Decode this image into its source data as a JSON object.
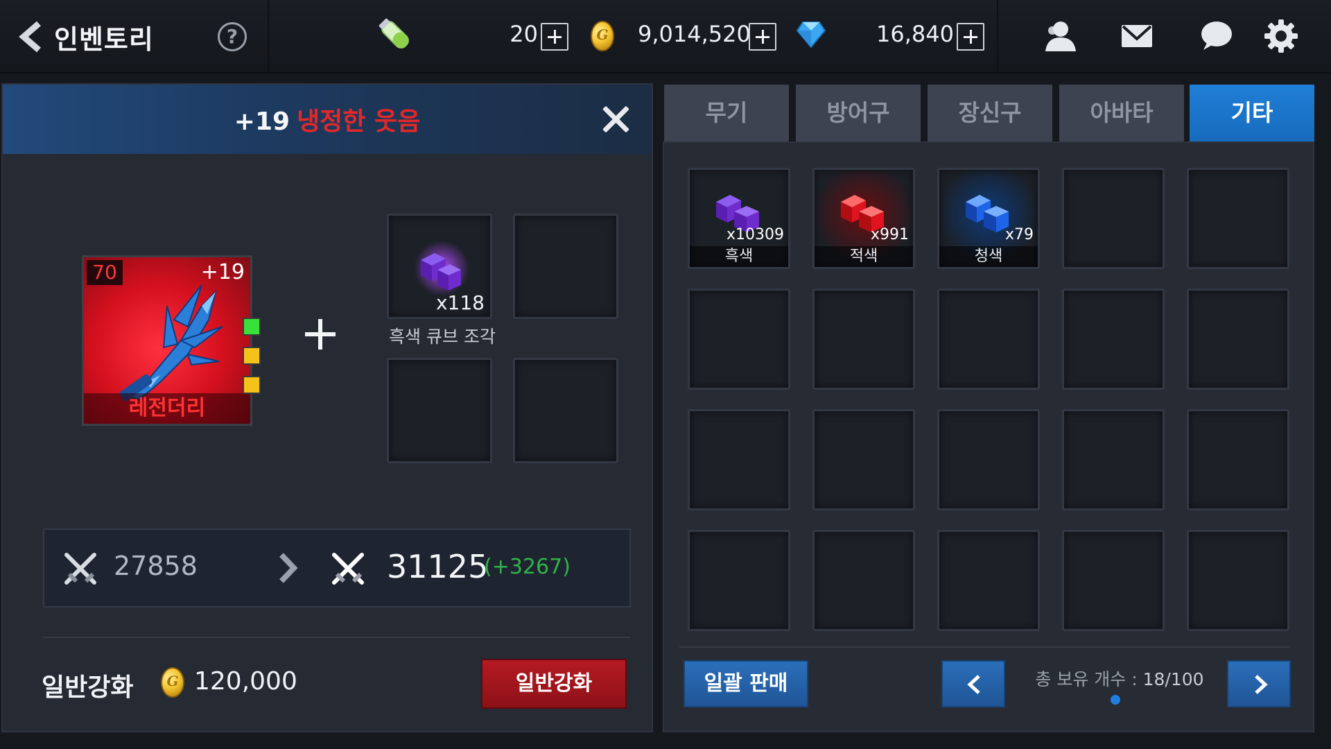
{
  "header": {
    "title": "인벤토리",
    "help_symbol": "?",
    "stamina_value": "20",
    "gold_value": "9,014,520",
    "gem_value": "16,840"
  },
  "enhance_panel": {
    "item_plus": "+19",
    "item_name": "냉정한 웃음",
    "weapon": {
      "level": "70",
      "plus": "+19",
      "grade": "레전더리",
      "gem_slot_colors": [
        "#39e03a",
        "#f5c21b",
        "#f5c21b"
      ]
    },
    "material": {
      "quantity": "x118",
      "label": "흑색 큐브 조각"
    },
    "stat": {
      "current": "27858",
      "next": "31125",
      "diff": "(+3267)"
    },
    "enhance_label": "일반강화",
    "enhance_cost": "120,000",
    "enhance_button": "일반강화"
  },
  "inventory": {
    "tabs": [
      {
        "label": "무기",
        "active": false
      },
      {
        "label": "방어구",
        "active": false
      },
      {
        "label": "장신구",
        "active": false
      },
      {
        "label": "아바타",
        "active": false
      },
      {
        "label": "기타",
        "active": true
      }
    ],
    "items": [
      {
        "name": "흑색",
        "qty": "x10309",
        "color": "#8a2be2"
      },
      {
        "name": "적색",
        "qty": "x991",
        "color": "#e0141e"
      },
      {
        "name": "청색",
        "qty": "x79",
        "color": "#1e64e8"
      }
    ],
    "bulk_sell_label": "일괄 판매",
    "total_label": "총 보유 개수 :",
    "total_count": "18/100"
  },
  "colors": {
    "accent_blue": "#1f7fd6",
    "legend_red": "#e3282a",
    "diff_green": "#2fb34a"
  }
}
